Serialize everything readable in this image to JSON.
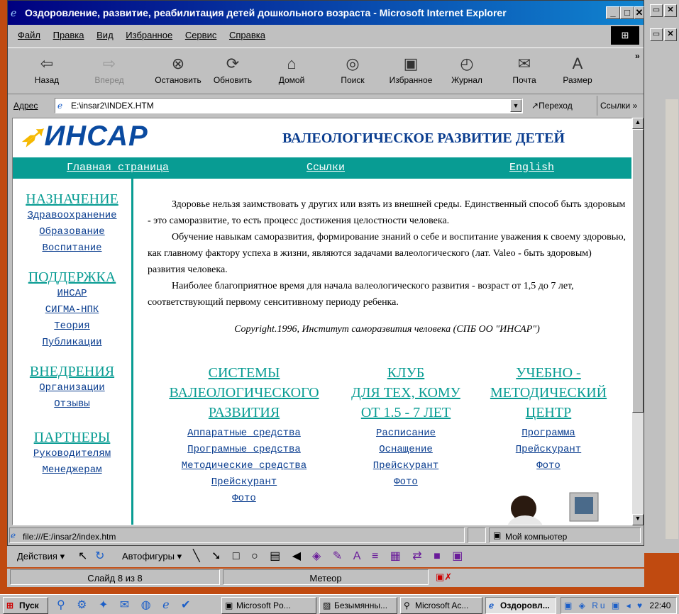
{
  "window": {
    "title": "Оздоровление, развитие, реабилитация детей дошкольного возраста - Microsoft Internet Explorer"
  },
  "menu": [
    "Файл",
    "Правка",
    "Вид",
    "Избранное",
    "Сервис",
    "Справка"
  ],
  "toolbar": [
    {
      "label": "Назад",
      "icon": "back-arrow-icon",
      "glyph": "⇦"
    },
    {
      "label": "Вперед",
      "icon": "forward-arrow-icon",
      "glyph": "⇨"
    },
    {
      "label": "Остановить",
      "icon": "stop-icon",
      "glyph": "⊗"
    },
    {
      "label": "Обновить",
      "icon": "refresh-icon",
      "glyph": "⟳"
    },
    {
      "label": "Домой",
      "icon": "home-icon",
      "glyph": "⌂"
    },
    {
      "label": "Поиск",
      "icon": "search-icon",
      "glyph": "◎"
    },
    {
      "label": "Избранное",
      "icon": "favorites-icon",
      "glyph": "▣"
    },
    {
      "label": "Журнал",
      "icon": "history-icon",
      "glyph": "◴"
    },
    {
      "label": "Почта",
      "icon": "mail-icon",
      "glyph": "✉"
    },
    {
      "label": "Размер",
      "icon": "font-size-icon",
      "glyph": "A"
    }
  ],
  "address": {
    "label": "Адрес",
    "value": "E:\\insar2\\INDEX.HTM",
    "go": "Переход",
    "links": "Ссылки"
  },
  "page": {
    "logo": "ИНСАР",
    "title": "ВАЛЕОЛОГИЧЕСКОЕ РАЗВИТИЕ ДЕТЕЙ",
    "nav": [
      "Главная страница",
      "Ссылки",
      "English"
    ],
    "sidebar": [
      {
        "heading": "НАЗНАЧЕНИЕ",
        "links": [
          "Здравоохранение",
          "Образование",
          "Воспитание"
        ]
      },
      {
        "heading": "ПОДДЕРЖКА",
        "links": [
          "ИНСАР",
          "СИГМА-НПК",
          "Теория",
          "Публикации"
        ]
      },
      {
        "heading": "ВНЕДРЕНИЯ",
        "links": [
          "Организации",
          "Отзывы"
        ]
      },
      {
        "heading": "ПАРТНЕРЫ",
        "links": [
          "Руководителям",
          "Менеджерам"
        ]
      }
    ],
    "paragraphs": [
      "Здоровье нельзя заимствовать у других или взять из внешней среды. Единственный способ быть здоровым - это саморазвитие, то есть процесс достижения целостности человека.",
      "Обучение навыкам саморазвития, формирование знаний о себе и воспитание уважения к своему здоровью, как главному фактору успеха в жизни, являются задачами валеологического (лат. Valeo - быть здоровым) развития человека.",
      "Наиболее благоприятное время для начала валеологического развития - возраст от 1,5 до 7 лет, соответствующий первому сенситивному периоду ребенка."
    ],
    "copyright": "Copyright.1996, Институт саморазвития человека (СПБ ОО \"ИНСАР\")",
    "columns": [
      {
        "heading": [
          "СИСТЕМЫ",
          "ВАЛЕОЛОГИЧЕСКОГО",
          "РАЗВИТИЯ"
        ],
        "links": [
          "Аппаратные средства",
          "Програмные средства",
          "Методические средства",
          "Прейскурант",
          "Фото"
        ]
      },
      {
        "heading": [
          "КЛУБ",
          "ДЛЯ ТЕХ, КОМУ",
          "ОТ 1.5 - 7 ЛЕТ"
        ],
        "links": [
          "Расписание",
          "Оснащение",
          "Прейскурант",
          "Фото"
        ]
      },
      {
        "heading": [
          "УЧЕБНО -",
          "МЕТОДИЧЕСКИЙ",
          "ЦЕНТР"
        ],
        "links": [
          "Программа",
          "Прейскурант",
          "Фото"
        ]
      }
    ]
  },
  "status": {
    "url": "file:///E:/insar2/index.htm",
    "zone": "Мой компьютер"
  },
  "ppt": {
    "actions": "Действия",
    "autoshapes": "Автофигуры",
    "slide": "Слайд 8 из 8",
    "design": "Метеор"
  },
  "taskbar": {
    "start": "Пуск",
    "tasks": [
      "Microsoft Po...",
      "Безымянны...",
      "Microsoft Ac...",
      "Оздоровл..."
    ],
    "clock": "22:40"
  },
  "colors": {
    "teal": "#089c93",
    "navy": "#0a3d8f",
    "title": "#000080"
  }
}
